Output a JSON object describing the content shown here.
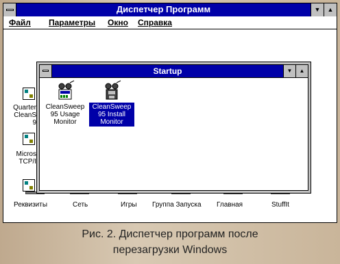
{
  "window": {
    "title": "Диспетчер Программ"
  },
  "menu": [
    "Файл",
    "Параметры",
    "Окно",
    "Справка"
  ],
  "left_groups": [
    {
      "label": "Quarter\nCleanS\n9"
    },
    {
      "label": "Micros\nTCP/I"
    }
  ],
  "bottom_groups": [
    "Реквизиты",
    "Сеть",
    "Игры",
    "Группа Запуска",
    "Главная",
    "StuffIt"
  ],
  "startup": {
    "title": "Startup",
    "items": [
      {
        "label": "CleanSweep\n95 Usage\nMonitor",
        "selected": false
      },
      {
        "label": "CleanSweep\n95 Install\nMonitor",
        "selected": true
      }
    ]
  },
  "caption": "Рис. 2. Диспетчер программ после\nперезагрузки Windows",
  "colors": {
    "titlebar": "#0000a8",
    "selection": "#0000a8"
  },
  "icons": [
    "system-menu-icon",
    "minimize-icon",
    "maximize-icon",
    "program-group-icon",
    "cleansweep-icon"
  ]
}
